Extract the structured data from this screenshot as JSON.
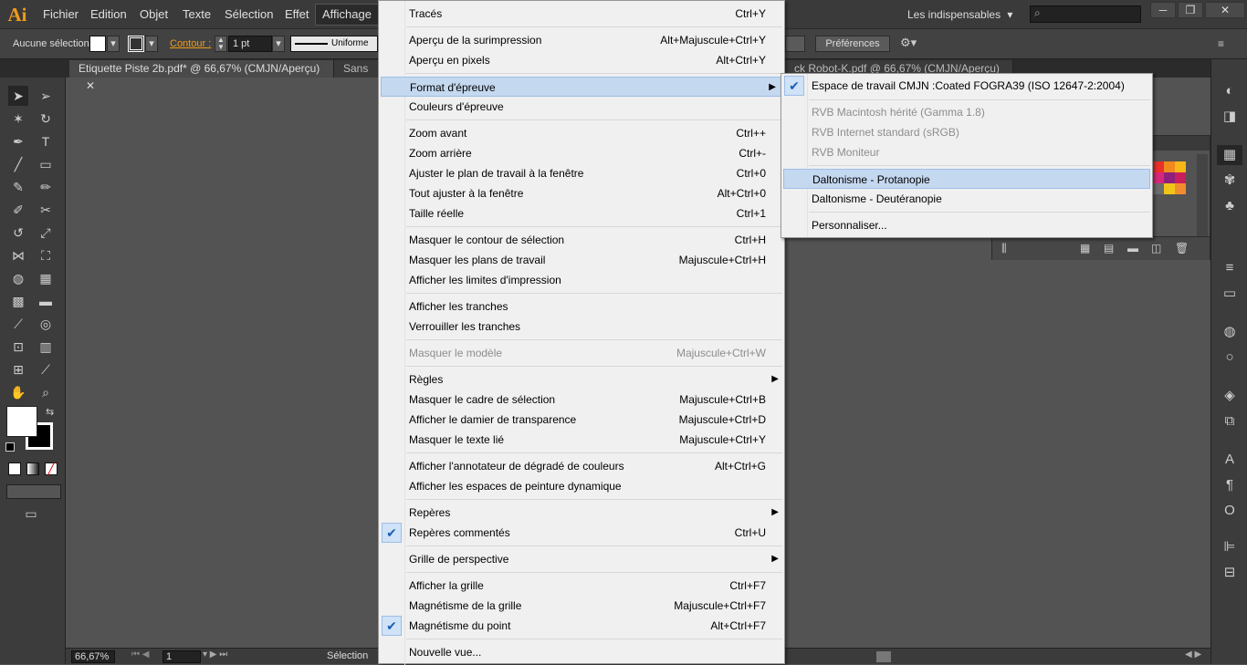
{
  "app": {
    "logo": "Ai"
  },
  "menubar": {
    "items": [
      "Fichier",
      "Edition",
      "Objet",
      "Texte",
      "Sélection",
      "Effet",
      "Affichage"
    ],
    "workspace": "Les indispensables",
    "workspace_arrow": "▾",
    "window_buttons": [
      "─",
      "❐",
      "✕"
    ]
  },
  "control_bar": {
    "selection_label": "Aucune sélection",
    "stroke_label": "Contour :",
    "stroke_weight": "1 pt",
    "stroke_style": "Uniforme",
    "preferences_button": "Préférences"
  },
  "tabs": [
    "Etiquette Piste 2b.pdf* @ 66,67% (CMJN/Aperçu)",
    "Sans tit",
    "ck Robot-K.pdf @ 66,67% (CMJN/Aperçu)"
  ],
  "tab_close": "✕",
  "status_bar": {
    "zoom": "66,67%",
    "artboard": "1",
    "mode": "Sélection"
  },
  "view_menu": {
    "items": [
      {
        "label": "Tracés",
        "shortcut": "Ctrl+Y"
      },
      {
        "label": "Aperçu de la surimpression",
        "shortcut": "Alt+Majuscule+Ctrl+Y"
      },
      {
        "label": "Aperçu en pixels",
        "shortcut": "Alt+Ctrl+Y"
      },
      {
        "label": "Format d'épreuve",
        "shortcut": "",
        "submenu": true
      },
      {
        "label": "Couleurs d'épreuve",
        "shortcut": ""
      },
      {
        "label": "Zoom avant",
        "shortcut": "Ctrl++"
      },
      {
        "label": "Zoom arrière",
        "shortcut": "Ctrl+-"
      },
      {
        "label": "Ajuster le plan de travail à la fenêtre",
        "shortcut": "Ctrl+0"
      },
      {
        "label": "Tout ajuster à la fenêtre",
        "shortcut": "Alt+Ctrl+0"
      },
      {
        "label": "Taille réelle",
        "shortcut": "Ctrl+1"
      },
      {
        "label": "Masquer le contour de sélection",
        "shortcut": "Ctrl+H"
      },
      {
        "label": "Masquer les plans de travail",
        "shortcut": "Majuscule+Ctrl+H"
      },
      {
        "label": "Afficher les limites d'impression",
        "shortcut": ""
      },
      {
        "label": "Afficher les tranches",
        "shortcut": ""
      },
      {
        "label": "Verrouiller les tranches",
        "shortcut": ""
      },
      {
        "label": "Masquer le modèle",
        "shortcut": "Majuscule+Ctrl+W",
        "disabled": true
      },
      {
        "label": "Règles",
        "shortcut": "",
        "submenu": true
      },
      {
        "label": "Masquer le cadre de sélection",
        "shortcut": "Majuscule+Ctrl+B"
      },
      {
        "label": "Afficher le damier de transparence",
        "shortcut": "Majuscule+Ctrl+D"
      },
      {
        "label": "Masquer le texte lié",
        "shortcut": "Majuscule+Ctrl+Y"
      },
      {
        "label": "Afficher l'annotateur de dégradé de couleurs",
        "shortcut": "Alt+Ctrl+G"
      },
      {
        "label": "Afficher les espaces de peinture dynamique",
        "shortcut": ""
      },
      {
        "label": "Repères",
        "shortcut": "",
        "submenu": true
      },
      {
        "label": "Repères commentés",
        "shortcut": "Ctrl+U",
        "checked": true
      },
      {
        "label": "Grille de perspective",
        "shortcut": "",
        "submenu": true
      },
      {
        "label": "Afficher la grille",
        "shortcut": "Ctrl+F7"
      },
      {
        "label": "Magnétisme de la grille",
        "shortcut": "Majuscule+Ctrl+F7"
      },
      {
        "label": "Magnétisme du point",
        "shortcut": "Alt+Ctrl+F7",
        "checked": true
      },
      {
        "label": "Nouvelle vue...",
        "shortcut": ""
      }
    ]
  },
  "proof_submenu": {
    "items": [
      {
        "label": "Espace de travail CMJN :Coated FOGRA39 (ISO 12647-2:2004)",
        "checked": true
      },
      {
        "label": "RVB Macintosh hérité (Gamma 1.8)",
        "disabled": true
      },
      {
        "label": "RVB Internet standard (sRGB)",
        "disabled": true
      },
      {
        "label": "RVB Moniteur",
        "disabled": true
      },
      {
        "label": "Daltonisme - Protanopie",
        "highlighted": true
      },
      {
        "label": "Daltonisme - Deutéranopie"
      },
      {
        "label": "Personnaliser..."
      }
    ]
  },
  "icons": {
    "check": "✔",
    "submenu_arrow": "▶",
    "dropdown_arrow": "▾"
  },
  "colors": {
    "highlight": "#c4d8f0",
    "accent_orange": "#f09c1a",
    "swatches": [
      "#e8312a",
      "#f08a1d",
      "#f7b718",
      "#d6287a",
      "#8e1f7e",
      "#c81e5b",
      "#6b6b6b",
      "#f0c419",
      "#f28d2f"
    ]
  }
}
